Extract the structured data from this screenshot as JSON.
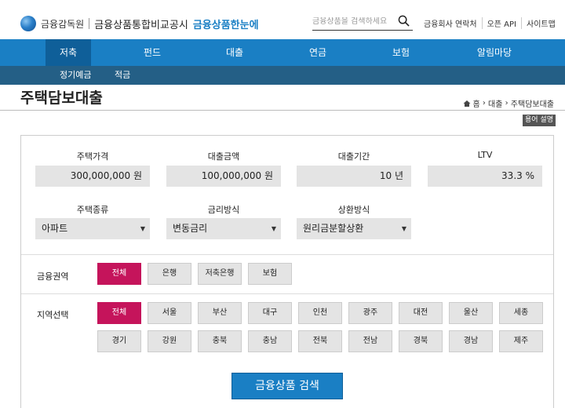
{
  "header": {
    "org_name": "금융감독원",
    "site_name": "금융상품통합비교공시",
    "brand": "금융상품한눈에",
    "search_placeholder": "금융상품을 검색하세요",
    "links": [
      "금융회사 연락처",
      "오픈 API",
      "사이트맵"
    ]
  },
  "nav": {
    "items": [
      "저축",
      "펀드",
      "대출",
      "연금",
      "보험",
      "알림마당"
    ],
    "active_index": 0,
    "sub_items": [
      "정기예금",
      "적금"
    ]
  },
  "page": {
    "title": "주택담보대출",
    "breadcrumb": [
      "홈",
      "대출",
      "주택담보대출"
    ],
    "term_button": "용어 설명"
  },
  "form": {
    "house_price": {
      "label": "주택가격",
      "value": "300,000,000",
      "unit": "원"
    },
    "loan_amount": {
      "label": "대출금액",
      "value": "100,000,000",
      "unit": "원"
    },
    "loan_period": {
      "label": "대출기간",
      "value": "10",
      "unit": "년"
    },
    "ltv": {
      "label": "LTV",
      "value": "33.3",
      "unit": "%"
    },
    "house_type": {
      "label": "주택종류",
      "selected": "아파트"
    },
    "rate_type": {
      "label": "금리방식",
      "selected": "변동금리"
    },
    "repay_type": {
      "label": "상환방식",
      "selected": "원리금분할상환"
    }
  },
  "sector": {
    "label": "금융권역",
    "options": [
      "전체",
      "은행",
      "저축은행",
      "보험"
    ],
    "selected": "전체"
  },
  "region": {
    "label": "지역선택",
    "options": [
      "전체",
      "서울",
      "부산",
      "대구",
      "인천",
      "광주",
      "대전",
      "울산",
      "세종",
      "경기",
      "강원",
      "충북",
      "충남",
      "전북",
      "전남",
      "경북",
      "경남",
      "제주"
    ],
    "selected": "전체"
  },
  "search_button": "금융상품 검색",
  "colors": {
    "primary": "#1a7fc4",
    "nav_dark": "#245f86",
    "active": "#c5145b"
  }
}
